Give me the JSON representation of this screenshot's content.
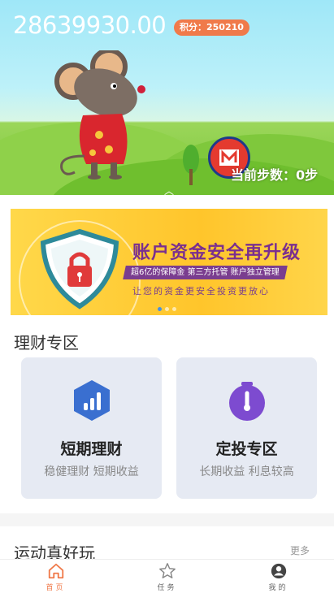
{
  "header": {
    "balance": "28639930.00",
    "points_label": "积分：250210",
    "steps_label": "当前步数：0步"
  },
  "banner": {
    "title": "账户资金安全再升级",
    "subtitle": "超6亿的保障金  第三方托管  账户独立管理",
    "tagline": "让您的资金更安全投资更放心",
    "slide_count": 3,
    "active_slide": 1
  },
  "finance": {
    "section_title": "理财专区",
    "cards": [
      {
        "title": "短期理财",
        "subtitle": "稳健理财 短期收益",
        "icon": "bar-chart-hexagon-icon",
        "color": "#3a6fd0"
      },
      {
        "title": "定投专区",
        "subtitle": "长期收益 利息较高",
        "icon": "timer-icon",
        "color": "#7d4bd0"
      }
    ]
  },
  "sport": {
    "section_title": "运动真好玩",
    "more_label": "更多"
  },
  "tabbar": {
    "items": [
      {
        "label": "首页",
        "icon": "home-icon",
        "active": true
      },
      {
        "label": "任务",
        "icon": "star-icon",
        "active": false
      },
      {
        "label": "我的",
        "icon": "user-icon",
        "active": false
      }
    ],
    "active_color": "#f07a4a"
  }
}
